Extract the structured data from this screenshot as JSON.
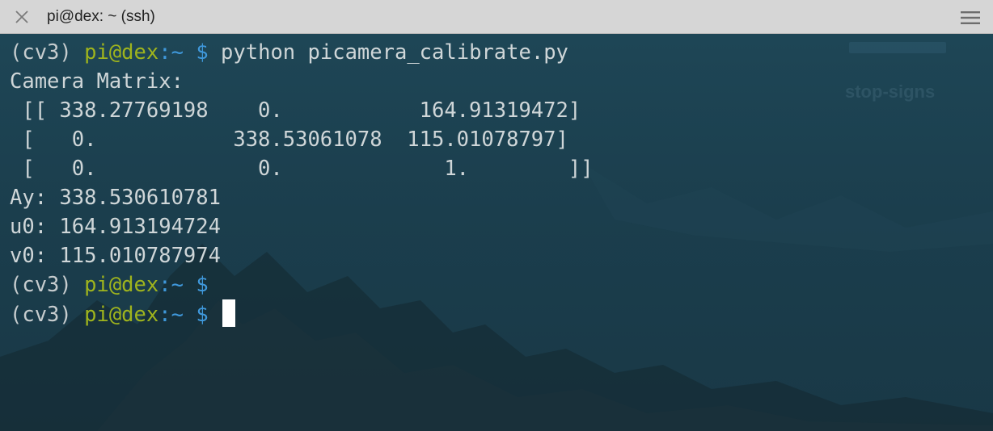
{
  "window": {
    "title": "pi@dex: ~ (ssh)",
    "close_icon": "close-icon",
    "menu_icon": "hamburger-menu-icon"
  },
  "background": {
    "label": "stop-signs"
  },
  "prompt": {
    "env": "(cv3)",
    "user_host": "pi@dex",
    "path": ":~",
    "symbol": "$"
  },
  "terminal": {
    "command": "python picamera_calibrate.py",
    "output": [
      "Camera Matrix:",
      " [[ 338.27769198    0.           164.91319472]",
      " [   0.           338.53061078  115.01078797]",
      " [   0.             0.             1.        ]]",
      "Ay: 338.530610781",
      "u0: 164.913194724",
      "v0: 115.010787974"
    ]
  },
  "colors": {
    "titlebar": "#d6d6d6",
    "terminal_bg": "#1b3e4d",
    "text": "#cfd6d8",
    "user_host": "#9fb41d",
    "path": "#3f98db"
  }
}
